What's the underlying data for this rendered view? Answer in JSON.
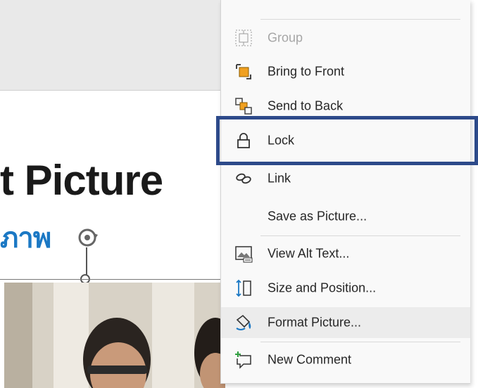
{
  "slide": {
    "title_fragment": "t Picture",
    "subtitle_fragment": "ภาพ"
  },
  "context_menu": {
    "items": [
      {
        "id": "group",
        "label": "Group",
        "icon": "group-icon",
        "enabled": false
      },
      {
        "id": "bring_to_front",
        "label": "Bring to Front",
        "icon": "bring-to-front-icon",
        "enabled": true
      },
      {
        "id": "send_to_back",
        "label": "Send to Back",
        "icon": "send-to-back-icon",
        "enabled": true
      },
      {
        "id": "lock",
        "label": "Lock",
        "icon": "lock-icon",
        "enabled": true,
        "highlighted": true
      },
      {
        "id": "link",
        "label": "Link",
        "icon": "link-icon",
        "enabled": true
      },
      {
        "id": "save_as_picture",
        "label": "Save as Picture...",
        "icon": "",
        "enabled": true
      },
      {
        "id": "view_alt_text",
        "label": "View Alt Text...",
        "icon": "alt-text-icon",
        "enabled": true
      },
      {
        "id": "size_and_position",
        "label": "Size and Position...",
        "icon": "size-position-icon",
        "enabled": true
      },
      {
        "id": "format_picture",
        "label": "Format Picture...",
        "icon": "format-picture-icon",
        "enabled": true,
        "hovered": true
      },
      {
        "id": "new_comment",
        "label": "New Comment",
        "icon": "new-comment-icon",
        "enabled": true
      }
    ]
  },
  "colors": {
    "highlight_border": "#2d4a8a",
    "accent_blue": "#1b78c4",
    "icon_orange": "#f0a020"
  }
}
